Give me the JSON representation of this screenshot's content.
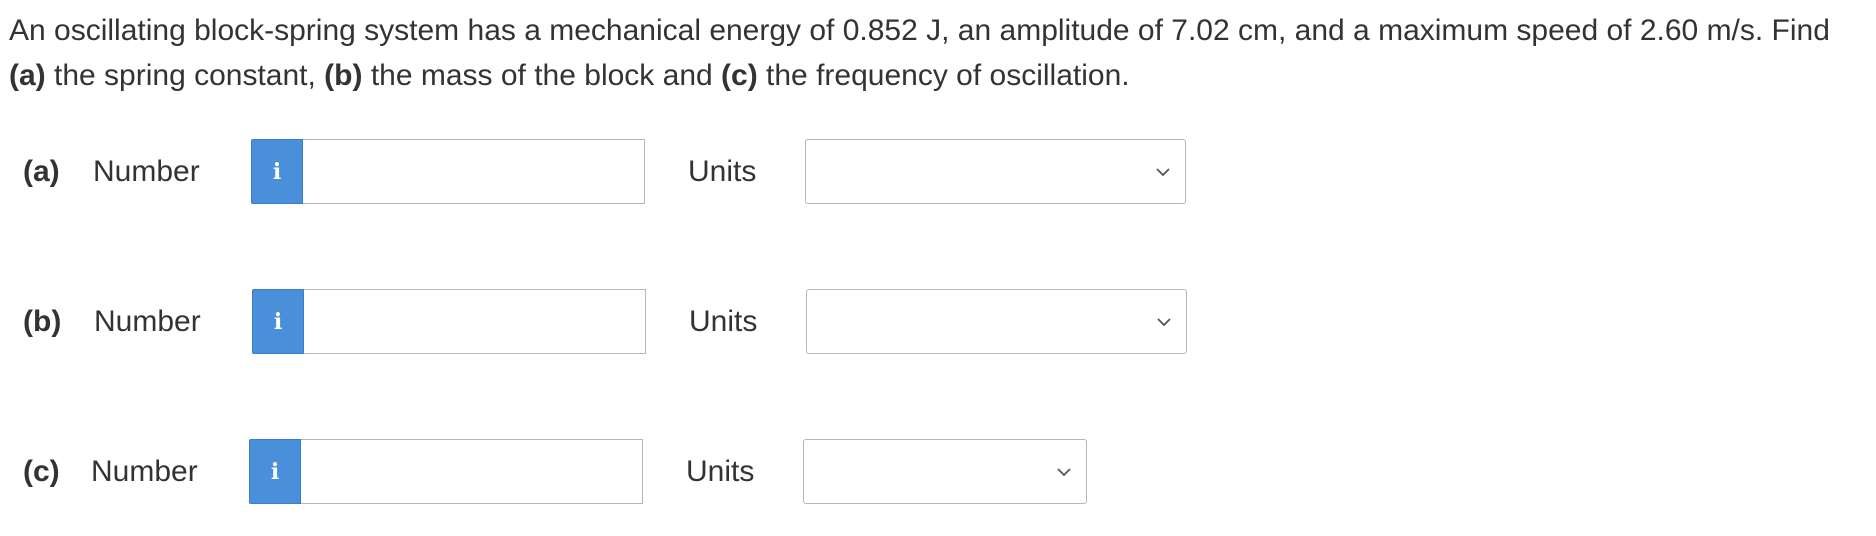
{
  "question": {
    "text_intro": "An oscillating block-spring system has a mechanical energy of 0.852 J, an amplitude of 7.02 cm, and a maximum speed of 2.60 m/s. Find",
    "part_a_marker": "(a)",
    "part_a_text": " the spring constant, ",
    "part_b_marker": "(b)",
    "part_b_text": " the mass of the block and ",
    "part_c_marker": "(c)",
    "part_c_text": " the frequency of oscillation."
  },
  "parts": [
    {
      "label": "(a)",
      "number_label": "Number",
      "info_icon": "i",
      "number_value": "",
      "units_label": "Units",
      "units_selected": ""
    },
    {
      "label": "(b)",
      "number_label": "Number",
      "info_icon": "i",
      "number_value": "",
      "units_label": "Units",
      "units_selected": ""
    },
    {
      "label": "(c)",
      "number_label": "Number",
      "info_icon": "i",
      "number_value": "",
      "units_label": "Units",
      "units_selected": ""
    }
  ],
  "colors": {
    "info_button": "#4a8fd9",
    "text": "#333333",
    "border": "#b7b7b7"
  }
}
